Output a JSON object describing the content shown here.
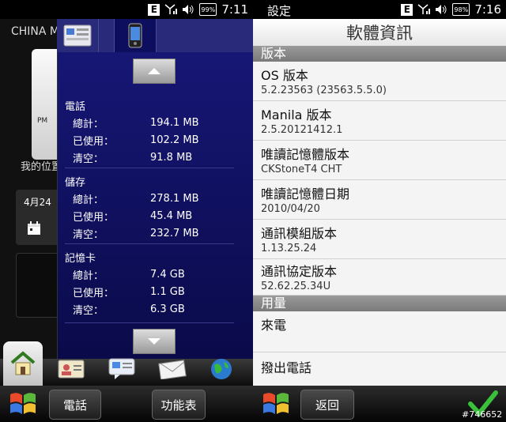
{
  "left_status": {
    "network": "E",
    "battery": "99%",
    "time": "7:11"
  },
  "right_status": {
    "app": "設定",
    "network": "E",
    "battery": "98%",
    "time": "7:16"
  },
  "home": {
    "carrier": "CHINA M",
    "clock_ampm": "PM",
    "location_text": "我的位置",
    "date_text": "4月24"
  },
  "memory": {
    "phone": {
      "title": "電話",
      "rows": [
        {
          "label": "總計：",
          "value": "194.1 MB"
        },
        {
          "label": "已使用：",
          "value": "102.2 MB"
        },
        {
          "label": "清空：",
          "value": "91.8 MB"
        }
      ]
    },
    "storage": {
      "title": "儲存",
      "rows": [
        {
          "label": "總計：",
          "value": "278.1 MB"
        },
        {
          "label": "已使用：",
          "value": "45.4 MB"
        },
        {
          "label": "清空：",
          "value": "232.7 MB"
        }
      ]
    },
    "card": {
      "title": "記憶卡",
      "rows": [
        {
          "label": "總計：",
          "value": "7.4 GB"
        },
        {
          "label": "已使用：",
          "value": "1.1 GB"
        },
        {
          "label": "清空：",
          "value": "6.3 GB"
        }
      ]
    }
  },
  "left_softkeys": {
    "left": "電話",
    "right": "功能表"
  },
  "software_info": {
    "title": "軟體資訊",
    "version_section": "版本",
    "items": [
      {
        "title": "OS 版本",
        "value": "5.2.23563 (23563.5.5.0)"
      },
      {
        "title": "Manila 版本",
        "value": "2.5.20121412.1"
      },
      {
        "title": "唯讀記憶體版本",
        "value": "CKStoneT4 CHT"
      },
      {
        "title": "唯讀記憶體日期",
        "value": "2010/04/20"
      },
      {
        "title": "通訊模組版本",
        "value": "1.13.25.24"
      },
      {
        "title": "通訊協定版本",
        "value": "52.62.25.34U"
      }
    ],
    "usage_section": "用量",
    "usage_items": [
      {
        "title": "來電"
      },
      {
        "title": "撥出電話"
      }
    ]
  },
  "right_softkeys": {
    "back": "返回"
  },
  "watermark": "#746652",
  "icons": [
    "signal-icon",
    "volume-icon",
    "battery-icon",
    "calendar-icon",
    "home-icon",
    "contacts-icon",
    "messages-icon",
    "mail-icon",
    "internet-icon",
    "windows-start-icon",
    "checkmark-icon",
    "scroll-up-icon",
    "scroll-down-icon"
  ]
}
